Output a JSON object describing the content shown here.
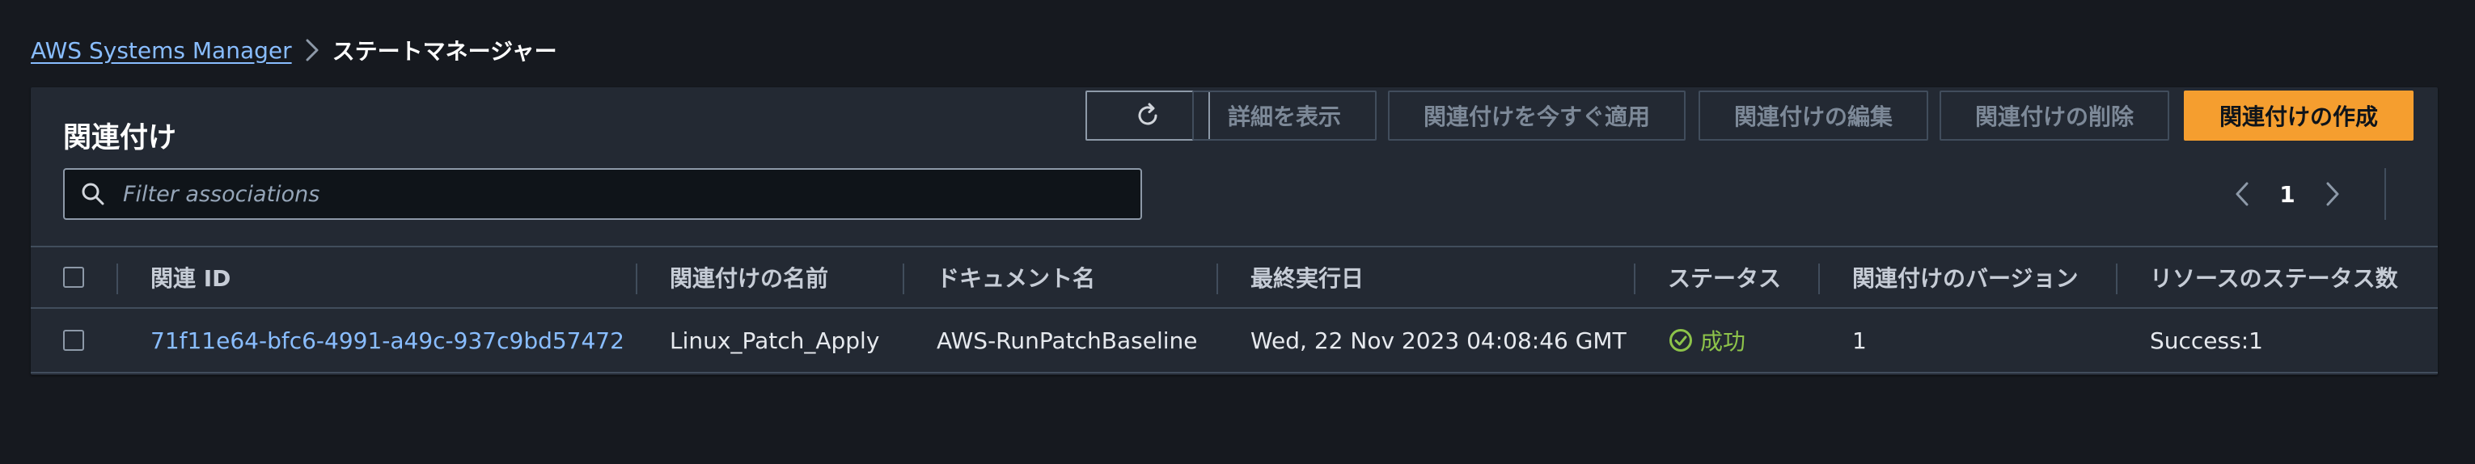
{
  "breadcrumb": {
    "root": "AWS Systems Manager",
    "current": "ステートマネージャー"
  },
  "panel": {
    "title": "関連付け",
    "buttons": {
      "view_details": "詳細を表示",
      "apply_now": "関連付けを今すぐ適用",
      "edit": "関連付けの編集",
      "delete": "関連付けの削除",
      "create": "関連付けの作成"
    },
    "search": {
      "placeholder": "Filter associations",
      "value": ""
    },
    "pagination": {
      "current_page": "1"
    }
  },
  "table": {
    "columns": {
      "association_id": "関連 ID",
      "name": "関連付けの名前",
      "document": "ドキュメント名",
      "last_execution": "最終実行日",
      "status": "ステータス",
      "version": "関連付けのバージョン",
      "resource_status": "リソースのステータス数"
    },
    "rows": [
      {
        "association_id": "71f11e64-bfc6-4991-a49c-937c9bd57472",
        "name": "Linux_Patch_Apply",
        "document": "AWS-RunPatchBaseline",
        "last_execution": "Wed, 22 Nov 2023 04:08:46 GMT",
        "status": "成功",
        "version": "1",
        "resource_status": "Success:1"
      }
    ]
  },
  "icons": {
    "breadcrumb_separator": "chevron-right-icon",
    "refresh": "refresh-icon",
    "search": "search-icon",
    "pager_prev": "chevron-left-icon",
    "pager_next": "chevron-right-icon",
    "status": "check-circle-icon"
  },
  "colors": {
    "background": "#16191f",
    "panel": "#232933",
    "link": "#89bdff",
    "primary": "#f59e2f",
    "success": "#8dc34a",
    "border": "#414d5c"
  }
}
